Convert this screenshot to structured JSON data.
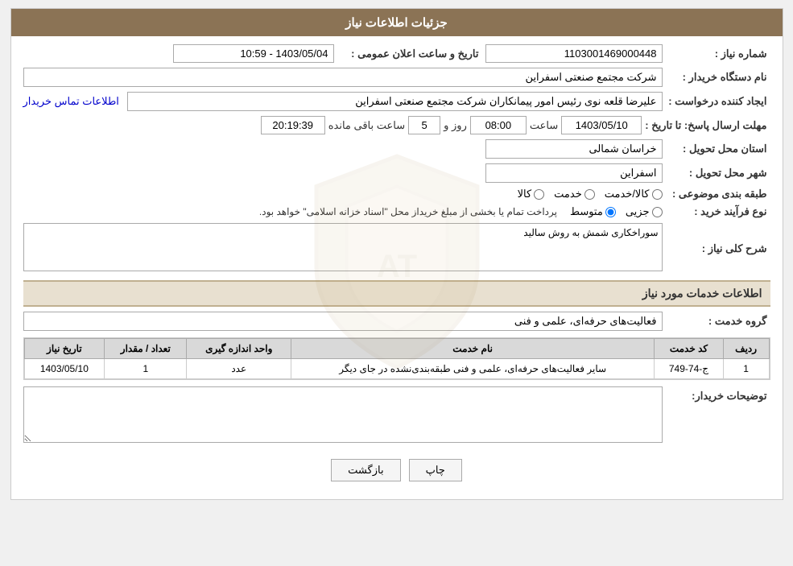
{
  "header": {
    "title": "جزئیات اطلاعات نیاز"
  },
  "fields": {
    "need_number_label": "شماره نیاز :",
    "need_number_value": "1103001469000448",
    "announcement_date_label": "تاریخ و ساعت اعلان عمومی :",
    "announcement_date_value": "1403/05/04 - 10:59",
    "buyer_name_label": "نام دستگاه خریدار :",
    "buyer_name_value": "شرکت مجتمع صنعتی اسفراین",
    "creator_label": "ایجاد کننده درخواست :",
    "creator_value": "علیرضا قلعه نوی رئیس امور پیمانکاران شرکت مجتمع صنعتی اسفراین",
    "contact_info_link": "اطلاعات تماس خریدار",
    "response_deadline_label": "مهلت ارسال پاسخ: تا تاریخ :",
    "response_date_value": "1403/05/10",
    "response_time_label": "ساعت",
    "response_time_value": "08:00",
    "remaining_days_label": "روز و",
    "remaining_days_value": "5",
    "remaining_time_label": "ساعت باقی مانده",
    "remaining_time_value": "20:19:39",
    "delivery_province_label": "استان محل تحویل :",
    "delivery_province_value": "خراسان شمالی",
    "delivery_city_label": "شهر محل تحویل :",
    "delivery_city_value": "اسفراین",
    "category_label": "طبقه بندی موضوعی :",
    "category_options": [
      {
        "label": "کالا",
        "selected": false
      },
      {
        "label": "خدمت",
        "selected": false
      },
      {
        "label": "کالا/خدمت",
        "selected": false
      }
    ],
    "purchase_type_label": "نوع فرآیند خرید :",
    "purchase_type_options": [
      {
        "label": "جزیی",
        "selected": false
      },
      {
        "label": "متوسط",
        "selected": true
      },
      {
        "label": "",
        "selected": false
      }
    ],
    "purchase_type_note": "پرداخت تمام یا بخشی از مبلغ خریداز محل \"اسناد خزانه اسلامی\" خواهد بود.",
    "need_description_label": "شرح کلی نیاز :",
    "need_description_value": "سوراخکاری شمش به روش سالید",
    "services_section_title": "اطلاعات خدمات مورد نیاز",
    "service_group_label": "گروه خدمت :",
    "service_group_value": "فعالیت‌های حرفه‌ای، علمی و فنی",
    "table_headers": [
      "ردیف",
      "کد خدمت",
      "نام خدمت",
      "واحد اندازه گیری",
      "تعداد / مقدار",
      "تاریخ نیاز"
    ],
    "table_rows": [
      {
        "row_num": "1",
        "service_code": "ج-74-749",
        "service_name": "سایر فعالیت‌های حرفه‌ای، علمی و فنی طبقه‌بندی‌نشده در جای دیگر",
        "unit": "عدد",
        "quantity": "1",
        "date": "1403/05/10"
      }
    ],
    "buyer_description_label": "توضیحات خریدار:",
    "print_button": "چاپ",
    "back_button": "بازگشت"
  }
}
